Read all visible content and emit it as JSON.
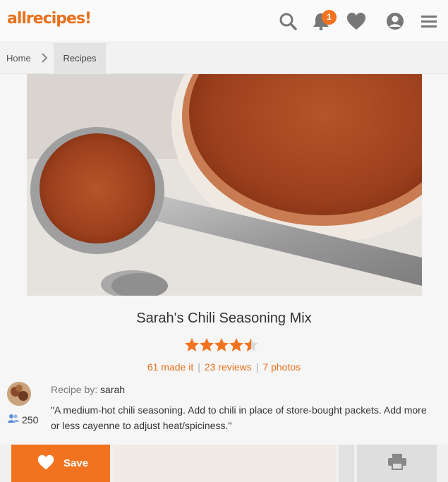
{
  "header": {
    "logo": "allrecipes",
    "notification_count": "1"
  },
  "breadcrumb": {
    "home": "Home",
    "current": "Recipes"
  },
  "recipe": {
    "title": "Sarah's Chili Seasoning Mix",
    "rating": 4.5,
    "made_it": "61 made it",
    "reviews": "23 reviews",
    "photos": "7 photos",
    "byline_label": "Recipe by:",
    "author": "sarah",
    "followers": "250",
    "description": "\"A medium-hot chili seasoning. Add to chili in place of store-bought packets. Add more or less cayenne to adjust heat/spiciness.\""
  },
  "actions": {
    "save_label": "Save"
  },
  "colors": {
    "accent": "#f2731f",
    "star": "#f2731f"
  },
  "icons": [
    "search-icon",
    "bell-icon",
    "heart-icon",
    "user-icon",
    "menu-icon",
    "chevron-right-icon",
    "followers-icon",
    "print-icon"
  ]
}
